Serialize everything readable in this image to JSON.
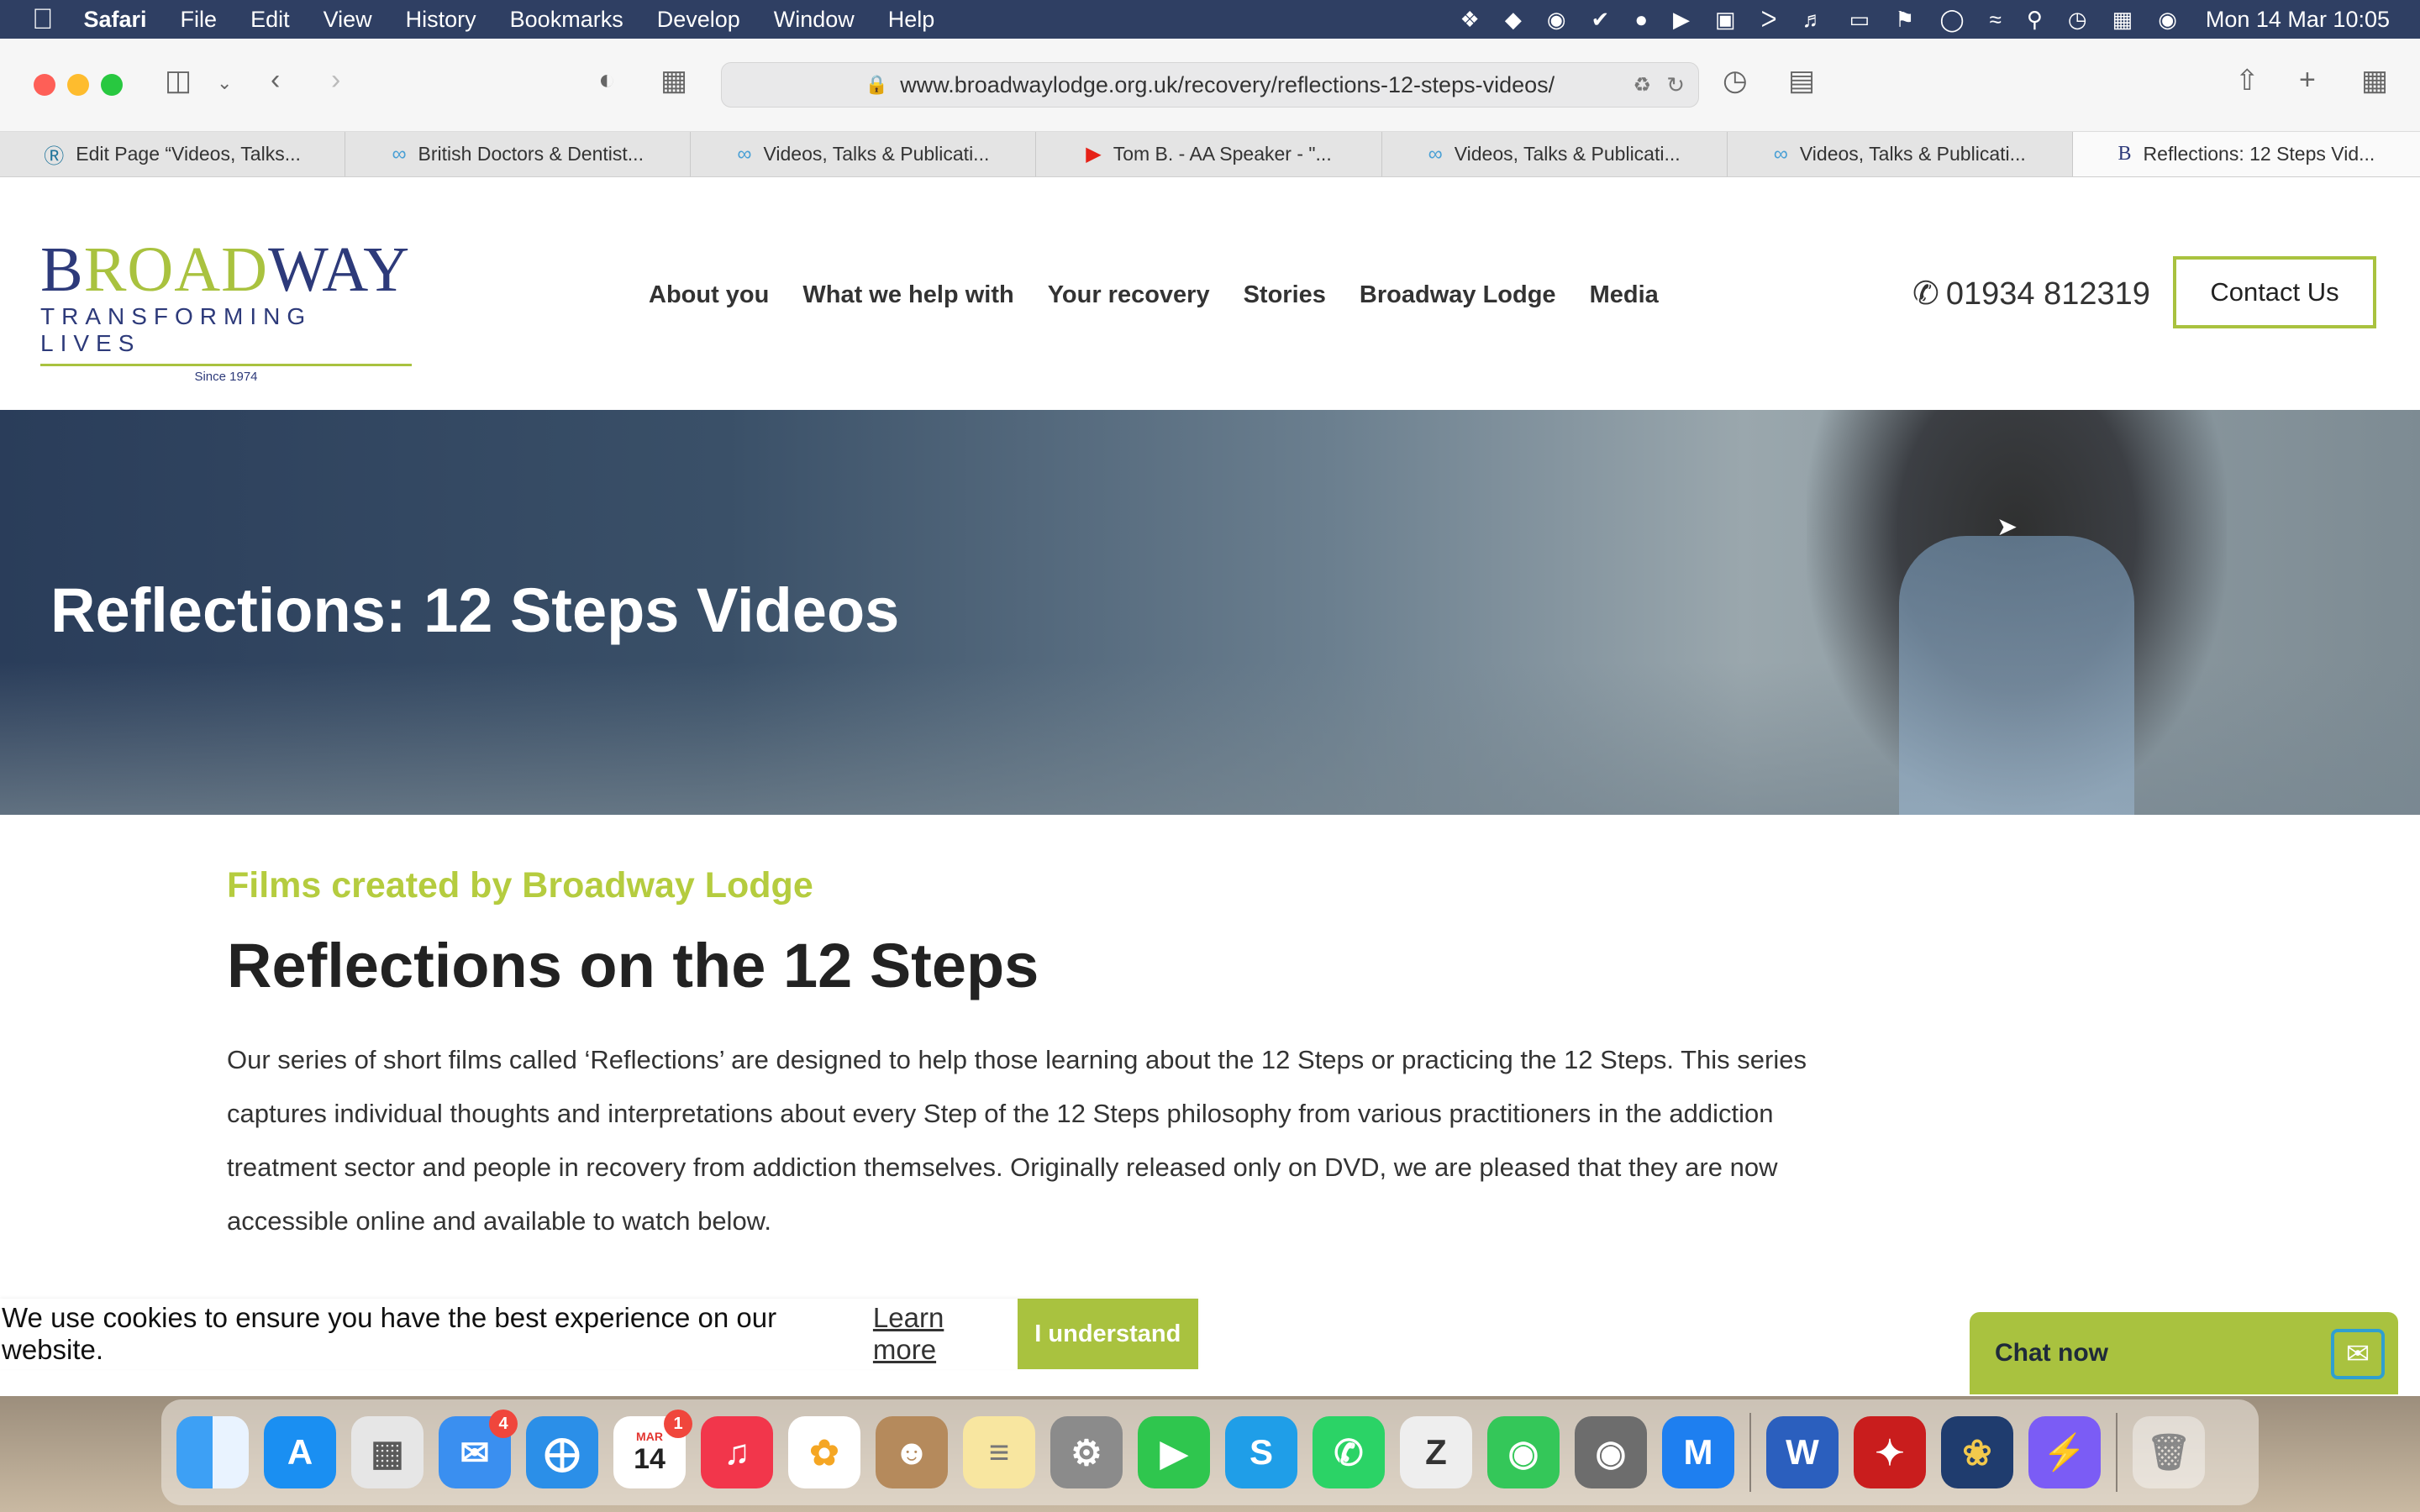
{
  "menubar": {
    "app": "Safari",
    "items": [
      "File",
      "Edit",
      "View",
      "History",
      "Bookmarks",
      "Develop",
      "Window",
      "Help"
    ],
    "clock": "Mon 14 Mar  10:05"
  },
  "browser": {
    "url": "www.broadwaylodge.org.uk/recovery/reflections-12-steps-videos/",
    "tabs": [
      {
        "label": "Edit Page “Videos, Talks...",
        "icon": "wordpress-icon"
      },
      {
        "label": "British Doctors & Dentist...",
        "icon": "site-icon"
      },
      {
        "label": "Videos, Talks & Publicati...",
        "icon": "site-icon"
      },
      {
        "label": "Tom B. - AA Speaker - \"...",
        "icon": "youtube-icon"
      },
      {
        "label": "Videos, Talks & Publicati...",
        "icon": "site-icon"
      },
      {
        "label": "Videos, Talks & Publicati...",
        "icon": "site-icon"
      },
      {
        "label": "Reflections: 12 Steps Vid...",
        "icon": "broadway-icon"
      }
    ]
  },
  "site": {
    "logo": {
      "word_a": "B",
      "word_b": "ROAD",
      "word_c": "WAY",
      "tagline": "TRANSFORMING LIVES",
      "since": "Since 1974"
    },
    "nav": [
      "About you",
      "What we help with",
      "Your recovery",
      "Stories",
      "Broadway Lodge",
      "Media"
    ],
    "phone": "01934 812319",
    "contact_label": "Contact Us"
  },
  "hero": {
    "title": "Reflections: 12 Steps Videos"
  },
  "content": {
    "kicker": "Films created by Broadway Lodge",
    "heading": "Reflections on the 12 Steps",
    "paragraph": "Our series of short films called ‘Reflections’ are designed to help those learning about the 12 Steps or practicing the 12 Steps. This series captures individual thoughts and interpretations about every Step of the 12 Steps philosophy from various practitioners in the addiction treatment sector and people in recovery from addiction themselves. Originally released only on DVD, we are pleased that they are now accessible online and available to watch below."
  },
  "cookie": {
    "message": "We use cookies to ensure you have the best experience on our website.",
    "learn_more": "Learn more",
    "accept": "I understand"
  },
  "chat": {
    "label": "Chat now"
  },
  "dock": {
    "mail_badge": "4",
    "calendar_month": "MAR",
    "calendar_day": "14",
    "calendar_badge": "1"
  },
  "colors": {
    "brand_green": "#a9c23f",
    "brand_navy": "#2d3a7a"
  }
}
